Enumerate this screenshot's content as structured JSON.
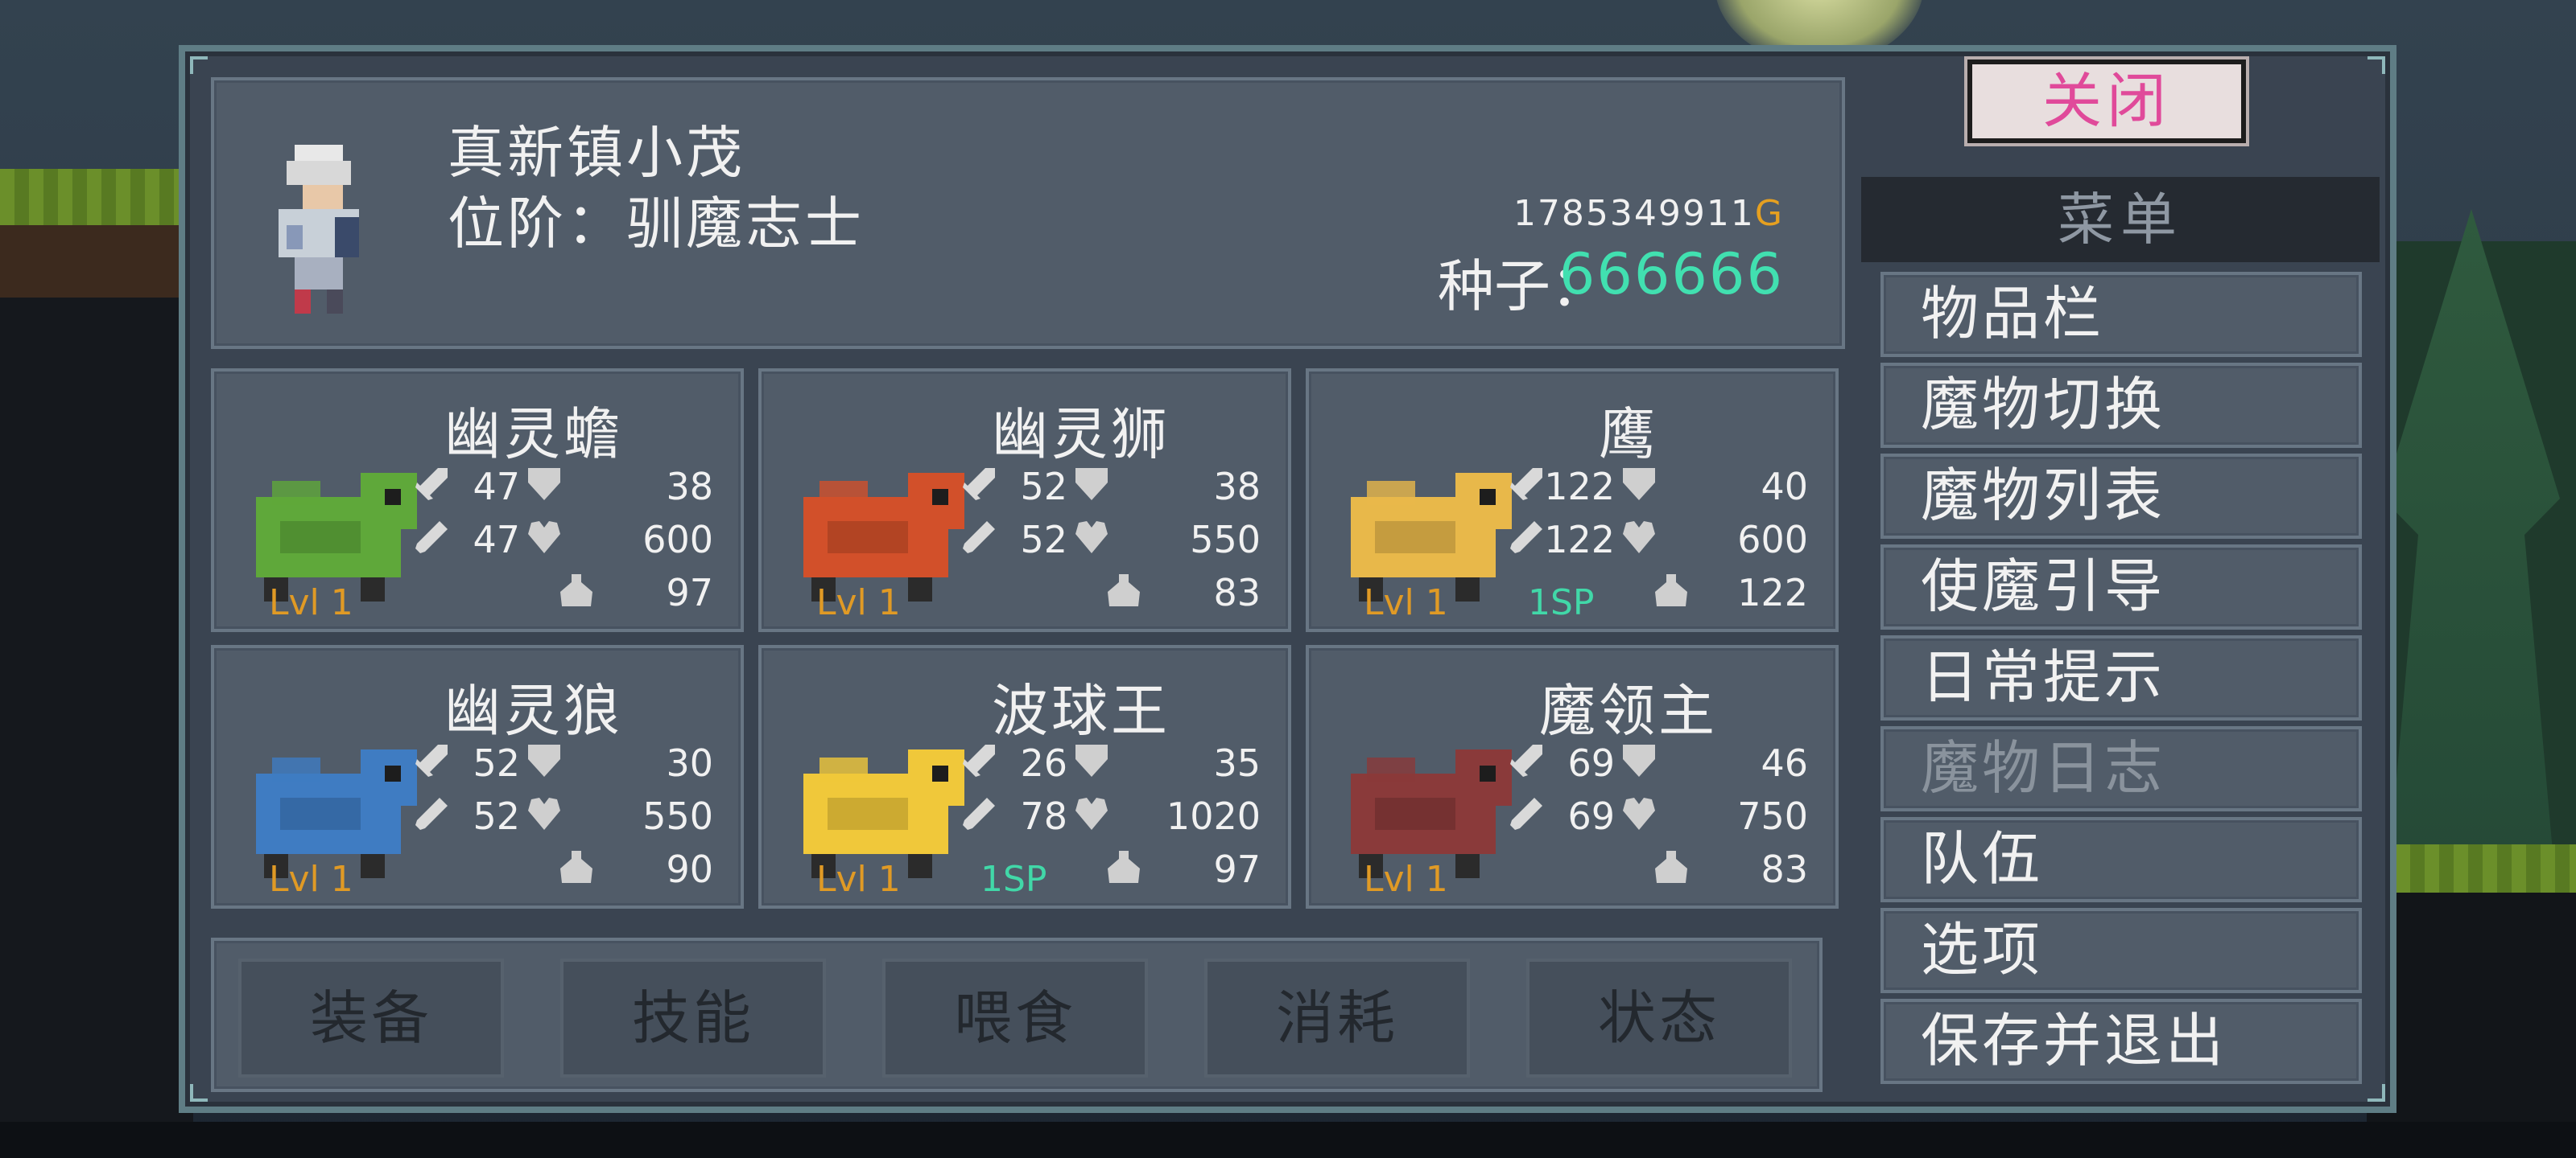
{
  "player": {
    "name": "真新镇小茂",
    "rank": "位阶：驯魔志士",
    "gold": "1785349911",
    "gold_suffix": "G",
    "seed_label": "种子：",
    "seed_value": "666666"
  },
  "monsters": [
    {
      "name": "幽灵蟾",
      "atk": "47",
      "def": "38",
      "matk": "47",
      "hp": "600",
      "food": "97",
      "level": "Lvl 1",
      "sp": "",
      "color": "#5fa83a"
    },
    {
      "name": "幽灵狮",
      "atk": "52",
      "def": "38",
      "matk": "52",
      "hp": "550",
      "food": "83",
      "level": "Lvl 1",
      "sp": "",
      "color": "#d2502a"
    },
    {
      "name": "鹰",
      "atk": "122",
      "def": "40",
      "matk": "122",
      "hp": "600",
      "food": "122",
      "level": "Lvl 1",
      "sp": "1SP",
      "color": "#e8b84a"
    },
    {
      "name": "幽灵狼",
      "atk": "52",
      "def": "30",
      "matk": "52",
      "hp": "550",
      "food": "90",
      "level": "Lvl 1",
      "sp": "",
      "color": "#3f7cc2"
    },
    {
      "name": "波球王",
      "atk": "26",
      "def": "35",
      "matk": "78",
      "hp": "1020",
      "food": "97",
      "level": "Lvl 1",
      "sp": "1SP",
      "color": "#f0c83a"
    },
    {
      "name": "魔领主",
      "atk": "69",
      "def": "46",
      "matk": "69",
      "hp": "750",
      "food": "83",
      "level": "Lvl 1",
      "sp": "",
      "color": "#8a3a3a"
    }
  ],
  "actions": [
    "装备",
    "技能",
    "喂食",
    "消耗",
    "状态"
  ],
  "menu": {
    "close_label": "关闭",
    "header": "菜单",
    "items": [
      {
        "label": "物品栏",
        "disabled": false
      },
      {
        "label": "魔物切换",
        "disabled": false
      },
      {
        "label": "魔物列表",
        "disabled": false
      },
      {
        "label": "使魔引导",
        "disabled": false
      },
      {
        "label": "日常提示",
        "disabled": false
      },
      {
        "label": "魔物日志",
        "disabled": true
      },
      {
        "label": "队伍",
        "disabled": false
      },
      {
        "label": "选项",
        "disabled": false
      },
      {
        "label": "保存并退出",
        "disabled": false
      }
    ]
  },
  "colors": {
    "gold": "#e6a020",
    "seed": "#41e0b0",
    "level": "#e09a25",
    "sp": "#41d8a8",
    "close_text": "#e04a9a"
  }
}
